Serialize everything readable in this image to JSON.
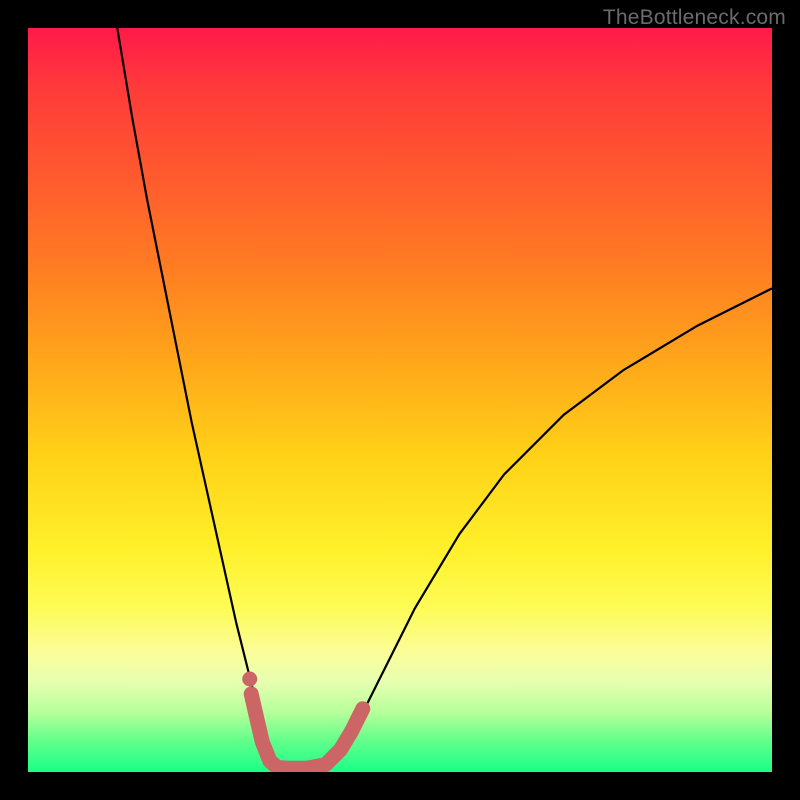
{
  "watermark": "TheBottleneck.com",
  "colors": {
    "frame": "#000000",
    "curve_stroke": "#000000",
    "thick_stroke": "#cc6666",
    "thick_fill": "#cc6666",
    "gradient_top": "#ff1a4a",
    "gradient_bottom": "#1aff88"
  },
  "chart_data": {
    "type": "line",
    "title": "",
    "xlabel": "",
    "ylabel": "",
    "xlim": [
      0,
      100
    ],
    "ylim": [
      0,
      100
    ],
    "grid": false,
    "series": [
      {
        "name": "curve",
        "x": [
          12,
          14,
          16,
          18,
          20,
          22,
          24,
          26,
          28,
          30,
          31,
          32,
          33,
          34,
          36,
          40,
          44,
          48,
          52,
          58,
          64,
          72,
          80,
          90,
          100
        ],
        "y": [
          100,
          88,
          77,
          67,
          57,
          47,
          38,
          29,
          20,
          12,
          8,
          4,
          1,
          0.5,
          0.5,
          1,
          6,
          14,
          22,
          32,
          40,
          48,
          54,
          60,
          65
        ]
      }
    ],
    "highlight_segment": {
      "name": "thick-bottom",
      "points": [
        {
          "x": 30.0,
          "y": 10.5
        },
        {
          "x": 30.8,
          "y": 7.0
        },
        {
          "x": 31.5,
          "y": 4.0
        },
        {
          "x": 32.5,
          "y": 1.5
        },
        {
          "x": 33.5,
          "y": 0.6
        },
        {
          "x": 35.0,
          "y": 0.5
        },
        {
          "x": 37.5,
          "y": 0.5
        },
        {
          "x": 40.0,
          "y": 1.0
        },
        {
          "x": 42.0,
          "y": 3.0
        },
        {
          "x": 43.5,
          "y": 5.5
        },
        {
          "x": 45.0,
          "y": 8.5
        }
      ],
      "dot": {
        "x": 29.8,
        "y": 12.5
      }
    }
  }
}
